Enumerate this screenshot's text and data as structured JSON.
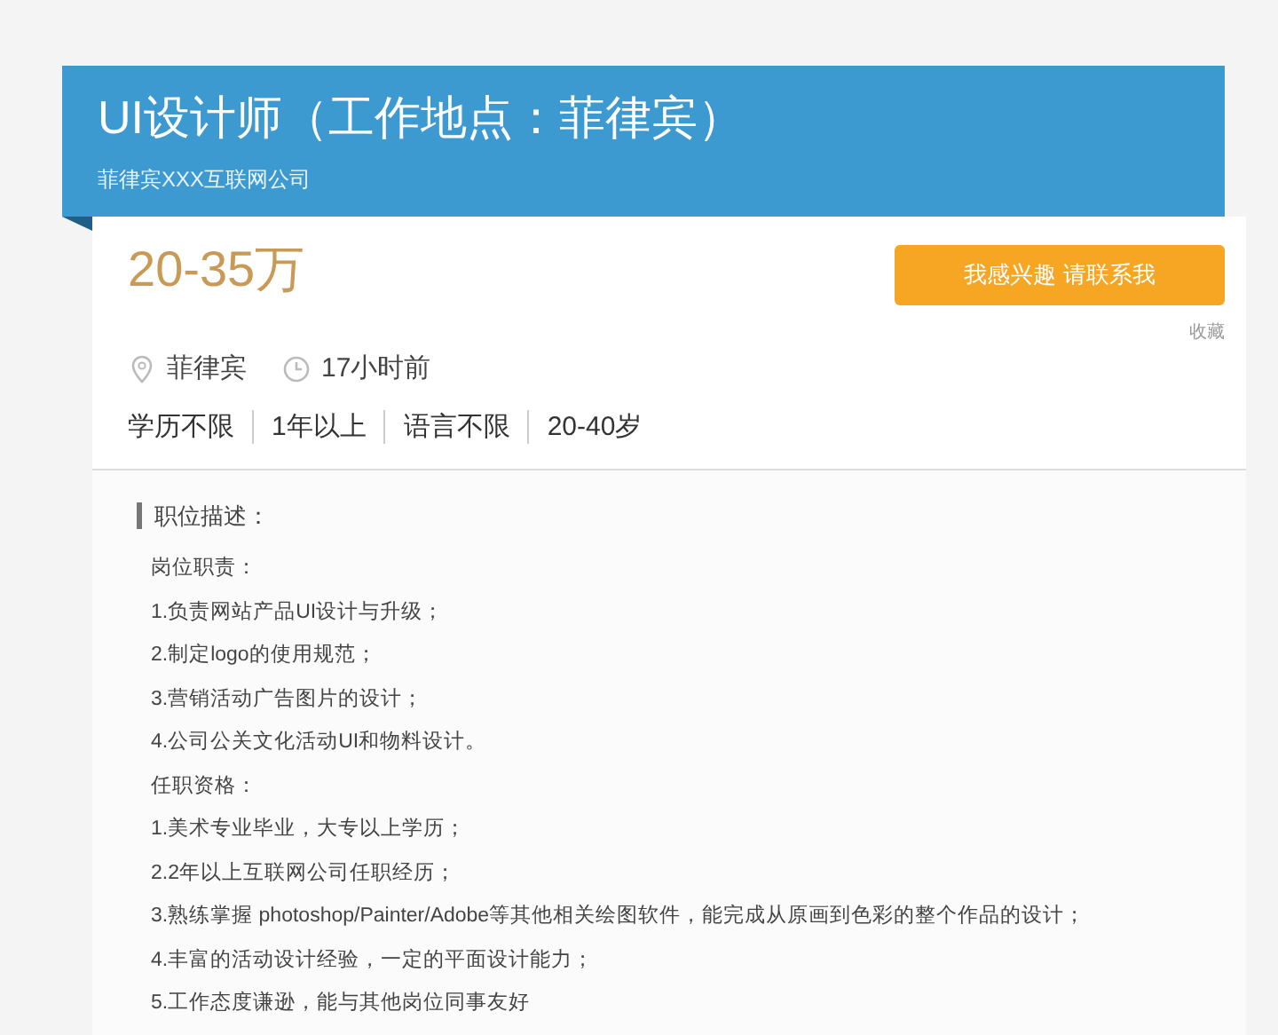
{
  "header": {
    "title": "UI设计师（工作地点：菲律宾）",
    "company": "菲律宾XXX互联网公司"
  },
  "summary": {
    "salary": "20-35万",
    "location": "菲律宾",
    "posted": "17小时前",
    "requirements": [
      "学历不限",
      "1年以上",
      "语言不限",
      "20-40岁"
    ],
    "contact_button": "我感兴趣 请联系我",
    "favorite_link": "收藏"
  },
  "description": {
    "heading": "职位描述：",
    "sections": [
      {
        "title": "岗位职责：",
        "items": [
          "1.负责网站产品UI设计与升级；",
          "2.制定logo的使用规范；",
          "3.营销活动广告图片的设计；",
          "4.公司公关文化活动UI和物料设计。"
        ]
      },
      {
        "title": "任职资格：",
        "items": [
          "1.美术专业毕业，大专以上学历；",
          "2.2年以上互联网公司任职经历；",
          "3.熟练掌握 photoshop/Painter/Adobe等其他相关绘图软件，能完成从原画到色彩的整个作品的设计；",
          "4.丰富的活动设计经验，一定的平面设计能力；",
          "5.工作态度谦逊，能与其他岗位同事友好"
        ]
      }
    ]
  }
}
